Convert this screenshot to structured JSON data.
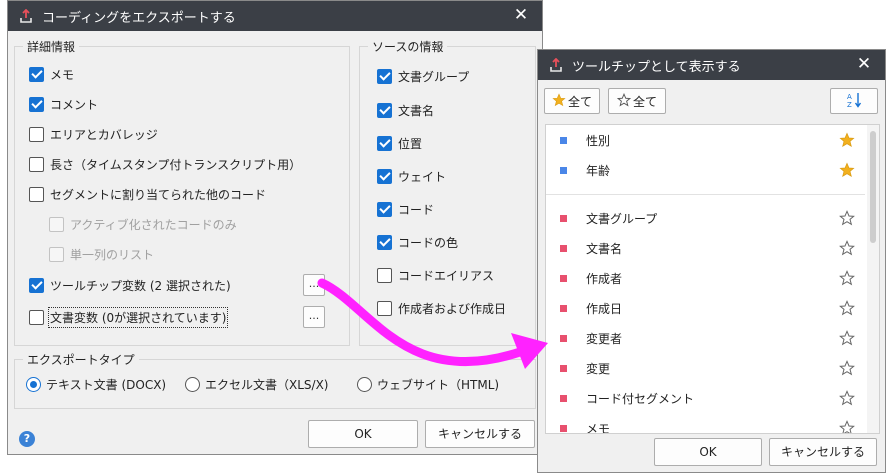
{
  "main_dialog": {
    "title": "コーディングをエクスポートする",
    "details_group": {
      "title": "詳細情報",
      "items": [
        {
          "label": "メモ",
          "checked": true
        },
        {
          "label": "コメント",
          "checked": true
        },
        {
          "label": "エリアとカバレッジ",
          "checked": false
        },
        {
          "label": "長さ（タイムスタンプ付トランスクリプト用）",
          "checked": false
        },
        {
          "label": "セグメントに割り当てられた他のコード",
          "checked": false
        },
        {
          "label": "アクティブ化されたコードのみ",
          "checked": false,
          "disabled": true
        },
        {
          "label": "単一列のリスト",
          "checked": false,
          "disabled": true
        },
        {
          "label": "ツールチップ変数 (2 選択された)",
          "checked": true
        },
        {
          "label": "文書変数 (0が選択されています)",
          "checked": false
        }
      ],
      "dots_label": "..."
    },
    "source_group": {
      "title": "ソースの情報",
      "items": [
        {
          "label": "文書グループ",
          "checked": true
        },
        {
          "label": "文書名",
          "checked": true
        },
        {
          "label": "位置",
          "checked": true
        },
        {
          "label": "ウェイト",
          "checked": true
        },
        {
          "label": "コード",
          "checked": true
        },
        {
          "label": "コードの色",
          "checked": true
        },
        {
          "label": "コードエイリアス",
          "checked": false
        },
        {
          "label": "作成者および作成日",
          "checked": false
        }
      ]
    },
    "export_type_group": {
      "title": "エクスポートタイプ",
      "options": [
        {
          "label": "テキスト文書 (DOCX)",
          "selected": true
        },
        {
          "label": "エクセル文書（XLS/X)",
          "selected": false
        },
        {
          "label": "ウェブサイト（HTML)",
          "selected": false
        }
      ]
    },
    "ok_label": "OK",
    "cancel_label": "キャンセルする",
    "help_label": "?"
  },
  "tooltip_dialog": {
    "title": "ツールチップとして表示する",
    "all_starred_label": "全て",
    "all_unstarred_label": "全て",
    "sort_label": "AZ",
    "variables_selected": [
      {
        "name": "性別",
        "starred": true,
        "color": "#4a86e8"
      },
      {
        "name": "年齢",
        "starred": true,
        "color": "#4a86e8"
      }
    ],
    "variables_other": [
      {
        "name": "文書グループ",
        "starred": false,
        "color": "#e8506e"
      },
      {
        "name": "文書名",
        "starred": false,
        "color": "#e8506e"
      },
      {
        "name": "作成者",
        "starred": false,
        "color": "#e8506e"
      },
      {
        "name": "作成日",
        "starred": false,
        "color": "#e8506e"
      },
      {
        "name": "変更者",
        "starred": false,
        "color": "#e8506e"
      },
      {
        "name": "変更",
        "starred": false,
        "color": "#e8506e"
      },
      {
        "name": "コード付セグメント",
        "starred": false,
        "color": "#e8506e"
      },
      {
        "name": "メモ",
        "starred": false,
        "color": "#e8506e"
      }
    ],
    "ok_label": "OK",
    "cancel_label": "キャンセルする"
  },
  "colors": {
    "titlebar": "#3b3f46",
    "checkbox_accent": "#1672d3",
    "star_filled": "#f2b01e",
    "arrow": "#ff22ff"
  }
}
